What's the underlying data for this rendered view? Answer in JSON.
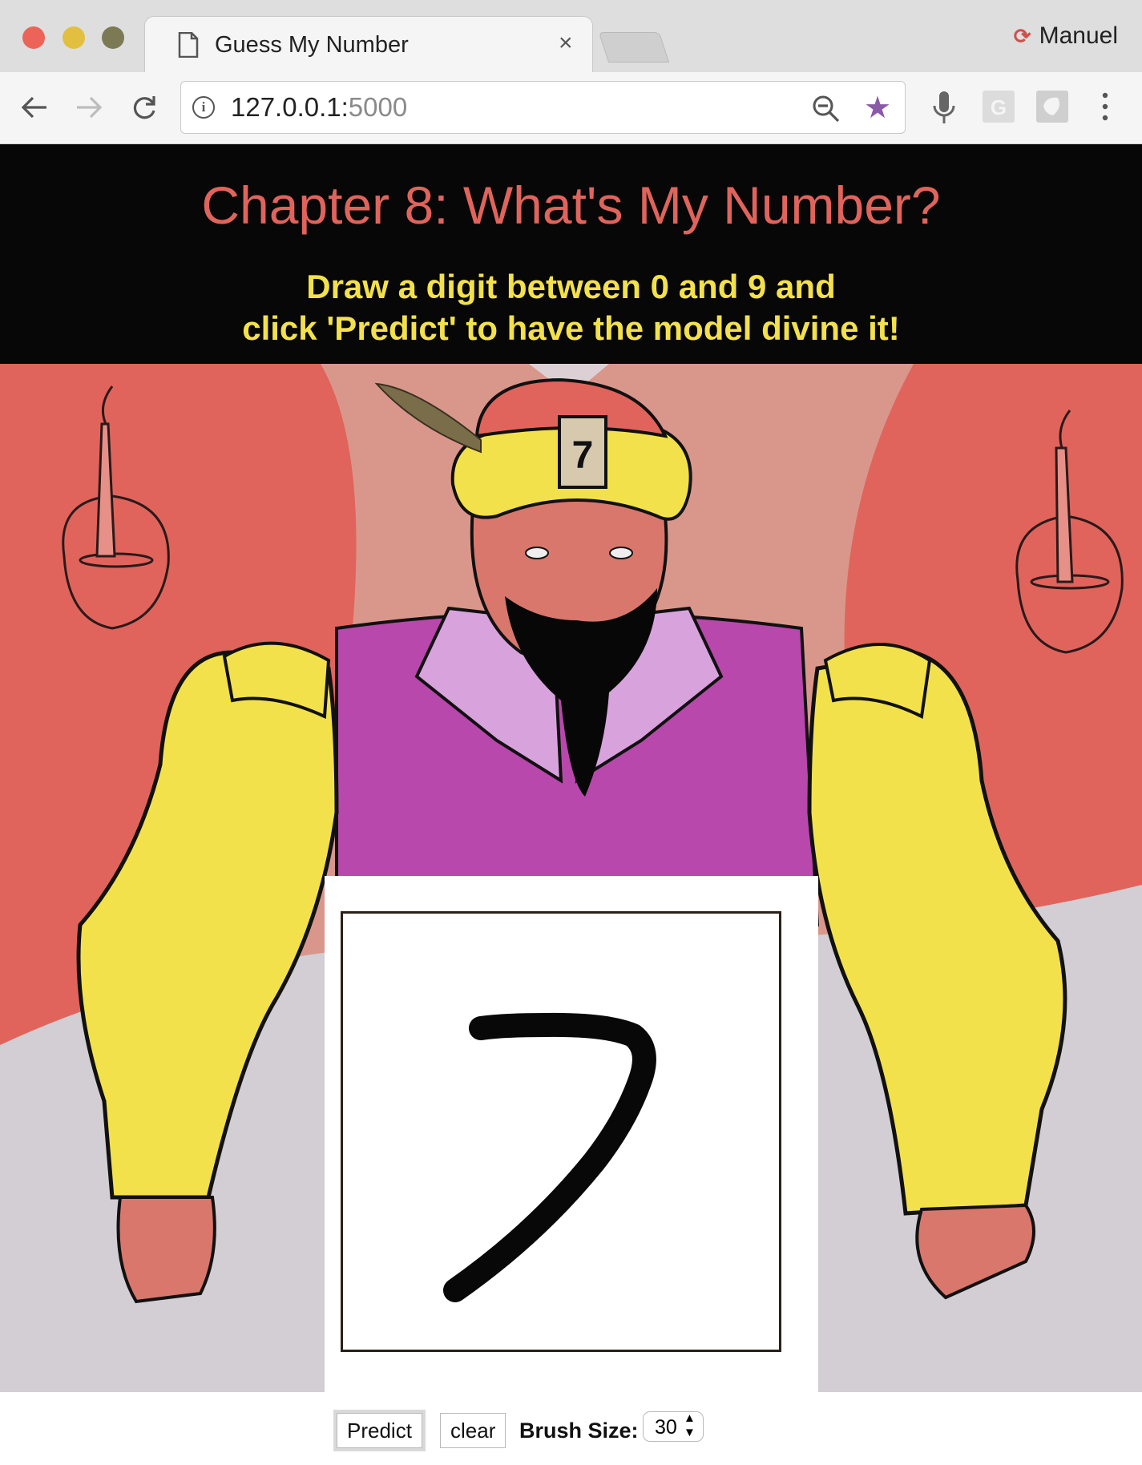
{
  "browser": {
    "tab_title": "Guess My Number",
    "tab_close": "×",
    "profile_name": "Manuel",
    "url_host": "127.0.0.1:",
    "url_port": "5000"
  },
  "page": {
    "title": "Chapter 8: What's My Number?",
    "subtitle": "Draw a digit between 0 and 9 and\nclick 'Predict' to have the model divine it!",
    "headband_digit": "7",
    "drawn_digit": "7"
  },
  "controls": {
    "predict_label": "Predict",
    "clear_label": "clear",
    "brush_label": "Brush Size:",
    "brush_value": "30"
  },
  "colors": {
    "header_bg": "#070707",
    "title": "#e0645c",
    "subtitle": "#f3e14c",
    "wall": "#d9978c",
    "curtain": "#e0645c",
    "robe": "#b848ac",
    "sleeves": "#f3e14c",
    "table": "#d2ced3"
  }
}
